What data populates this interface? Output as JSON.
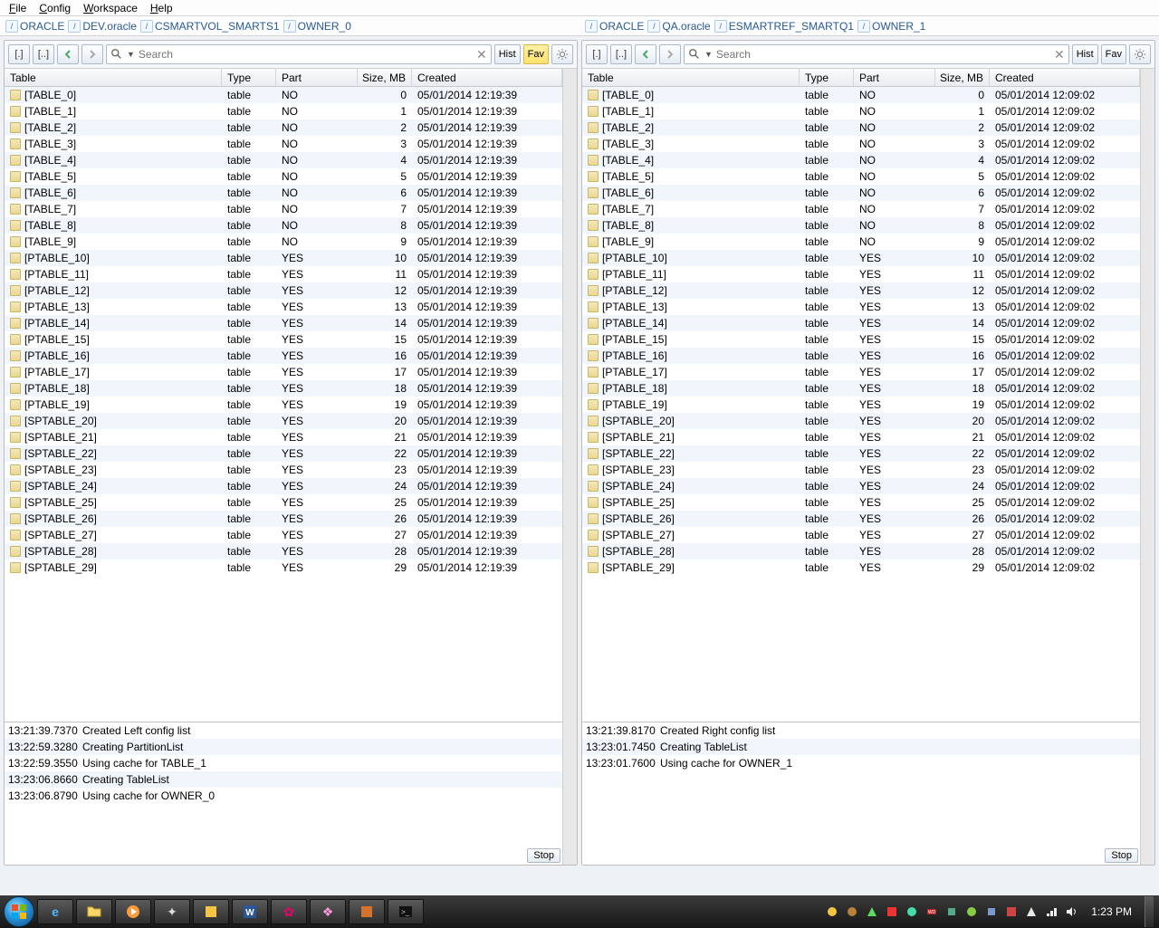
{
  "menu": {
    "file": "File",
    "config": "Config",
    "workspace": "Workspace",
    "help": "Help"
  },
  "breadcrumbs": {
    "left": [
      "ORACLE",
      "DEV.oracle",
      "CSMARTVOL_SMARTS1",
      "OWNER_0"
    ],
    "right": [
      "ORACLE",
      "QA.oracle",
      "ESMARTREF_SMARTQ1",
      "OWNER_1"
    ]
  },
  "toolbar": {
    "dot": "[.]",
    "dotdot": "[..]",
    "hist": "Hist",
    "fav": "Fav",
    "search_placeholder": "Search"
  },
  "columns": {
    "table": "Table",
    "type": "Type",
    "part": "Part",
    "size": "Size, MB",
    "created": "Created"
  },
  "left": {
    "created": "05/01/2014 12:19:39",
    "rows": [
      {
        "name": "[TABLE_0]",
        "type": "table",
        "part": "NO",
        "size": 0
      },
      {
        "name": "[TABLE_1]",
        "type": "table",
        "part": "NO",
        "size": 1
      },
      {
        "name": "[TABLE_2]",
        "type": "table",
        "part": "NO",
        "size": 2
      },
      {
        "name": "[TABLE_3]",
        "type": "table",
        "part": "NO",
        "size": 3
      },
      {
        "name": "[TABLE_4]",
        "type": "table",
        "part": "NO",
        "size": 4
      },
      {
        "name": "[TABLE_5]",
        "type": "table",
        "part": "NO",
        "size": 5
      },
      {
        "name": "[TABLE_6]",
        "type": "table",
        "part": "NO",
        "size": 6
      },
      {
        "name": "[TABLE_7]",
        "type": "table",
        "part": "NO",
        "size": 7
      },
      {
        "name": "[TABLE_8]",
        "type": "table",
        "part": "NO",
        "size": 8
      },
      {
        "name": "[TABLE_9]",
        "type": "table",
        "part": "NO",
        "size": 9
      },
      {
        "name": "[PTABLE_10]",
        "type": "table",
        "part": "YES",
        "size": 10
      },
      {
        "name": "[PTABLE_11]",
        "type": "table",
        "part": "YES",
        "size": 11
      },
      {
        "name": "[PTABLE_12]",
        "type": "table",
        "part": "YES",
        "size": 12
      },
      {
        "name": "[PTABLE_13]",
        "type": "table",
        "part": "YES",
        "size": 13
      },
      {
        "name": "[PTABLE_14]",
        "type": "table",
        "part": "YES",
        "size": 14
      },
      {
        "name": "[PTABLE_15]",
        "type": "table",
        "part": "YES",
        "size": 15
      },
      {
        "name": "[PTABLE_16]",
        "type": "table",
        "part": "YES",
        "size": 16
      },
      {
        "name": "[PTABLE_17]",
        "type": "table",
        "part": "YES",
        "size": 17
      },
      {
        "name": "[PTABLE_18]",
        "type": "table",
        "part": "YES",
        "size": 18
      },
      {
        "name": "[PTABLE_19]",
        "type": "table",
        "part": "YES",
        "size": 19
      },
      {
        "name": "[SPTABLE_20]",
        "type": "table",
        "part": "YES",
        "size": 20
      },
      {
        "name": "[SPTABLE_21]",
        "type": "table",
        "part": "YES",
        "size": 21
      },
      {
        "name": "[SPTABLE_22]",
        "type": "table",
        "part": "YES",
        "size": 22
      },
      {
        "name": "[SPTABLE_23]",
        "type": "table",
        "part": "YES",
        "size": 23
      },
      {
        "name": "[SPTABLE_24]",
        "type": "table",
        "part": "YES",
        "size": 24
      },
      {
        "name": "[SPTABLE_25]",
        "type": "table",
        "part": "YES",
        "size": 25
      },
      {
        "name": "[SPTABLE_26]",
        "type": "table",
        "part": "YES",
        "size": 26
      },
      {
        "name": "[SPTABLE_27]",
        "type": "table",
        "part": "YES",
        "size": 27
      },
      {
        "name": "[SPTABLE_28]",
        "type": "table",
        "part": "YES",
        "size": 28
      },
      {
        "name": "[SPTABLE_29]",
        "type": "table",
        "part": "YES",
        "size": 29
      }
    ],
    "log": [
      {
        "ts": "13:21:39.7370",
        "msg": "Created Left config list"
      },
      {
        "ts": "13:22:59.3280",
        "msg": "Creating PartitionList"
      },
      {
        "ts": "13:22:59.3550",
        "msg": "Using cache for TABLE_1"
      },
      {
        "ts": "13:23:06.8660",
        "msg": "Creating TableList"
      },
      {
        "ts": "13:23:06.8790",
        "msg": "Using cache for OWNER_0"
      }
    ]
  },
  "right": {
    "created": "05/01/2014 12:09:02",
    "rows": [
      {
        "name": "[TABLE_0]",
        "type": "table",
        "part": "NO",
        "size": 0
      },
      {
        "name": "[TABLE_1]",
        "type": "table",
        "part": "NO",
        "size": 1
      },
      {
        "name": "[TABLE_2]",
        "type": "table",
        "part": "NO",
        "size": 2
      },
      {
        "name": "[TABLE_3]",
        "type": "table",
        "part": "NO",
        "size": 3
      },
      {
        "name": "[TABLE_4]",
        "type": "table",
        "part": "NO",
        "size": 4
      },
      {
        "name": "[TABLE_5]",
        "type": "table",
        "part": "NO",
        "size": 5
      },
      {
        "name": "[TABLE_6]",
        "type": "table",
        "part": "NO",
        "size": 6
      },
      {
        "name": "[TABLE_7]",
        "type": "table",
        "part": "NO",
        "size": 7
      },
      {
        "name": "[TABLE_8]",
        "type": "table",
        "part": "NO",
        "size": 8
      },
      {
        "name": "[TABLE_9]",
        "type": "table",
        "part": "NO",
        "size": 9
      },
      {
        "name": "[PTABLE_10]",
        "type": "table",
        "part": "YES",
        "size": 10
      },
      {
        "name": "[PTABLE_11]",
        "type": "table",
        "part": "YES",
        "size": 11
      },
      {
        "name": "[PTABLE_12]",
        "type": "table",
        "part": "YES",
        "size": 12
      },
      {
        "name": "[PTABLE_13]",
        "type": "table",
        "part": "YES",
        "size": 13
      },
      {
        "name": "[PTABLE_14]",
        "type": "table",
        "part": "YES",
        "size": 14
      },
      {
        "name": "[PTABLE_15]",
        "type": "table",
        "part": "YES",
        "size": 15
      },
      {
        "name": "[PTABLE_16]",
        "type": "table",
        "part": "YES",
        "size": 16
      },
      {
        "name": "[PTABLE_17]",
        "type": "table",
        "part": "YES",
        "size": 17
      },
      {
        "name": "[PTABLE_18]",
        "type": "table",
        "part": "YES",
        "size": 18
      },
      {
        "name": "[PTABLE_19]",
        "type": "table",
        "part": "YES",
        "size": 19
      },
      {
        "name": "[SPTABLE_20]",
        "type": "table",
        "part": "YES",
        "size": 20
      },
      {
        "name": "[SPTABLE_21]",
        "type": "table",
        "part": "YES",
        "size": 21
      },
      {
        "name": "[SPTABLE_22]",
        "type": "table",
        "part": "YES",
        "size": 22
      },
      {
        "name": "[SPTABLE_23]",
        "type": "table",
        "part": "YES",
        "size": 23
      },
      {
        "name": "[SPTABLE_24]",
        "type": "table",
        "part": "YES",
        "size": 24
      },
      {
        "name": "[SPTABLE_25]",
        "type": "table",
        "part": "YES",
        "size": 25
      },
      {
        "name": "[SPTABLE_26]",
        "type": "table",
        "part": "YES",
        "size": 26
      },
      {
        "name": "[SPTABLE_27]",
        "type": "table",
        "part": "YES",
        "size": 27
      },
      {
        "name": "[SPTABLE_28]",
        "type": "table",
        "part": "YES",
        "size": 28
      },
      {
        "name": "[SPTABLE_29]",
        "type": "table",
        "part": "YES",
        "size": 29
      }
    ],
    "log": [
      {
        "ts": "13:21:39.8170",
        "msg": "Created Right config list"
      },
      {
        "ts": "13:23:01.7450",
        "msg": "Creating TableList"
      },
      {
        "ts": "13:23:01.7600",
        "msg": "Using cache for OWNER_1"
      }
    ]
  },
  "stop_label": "Stop",
  "taskbar": {
    "clock": "1:23 PM"
  }
}
